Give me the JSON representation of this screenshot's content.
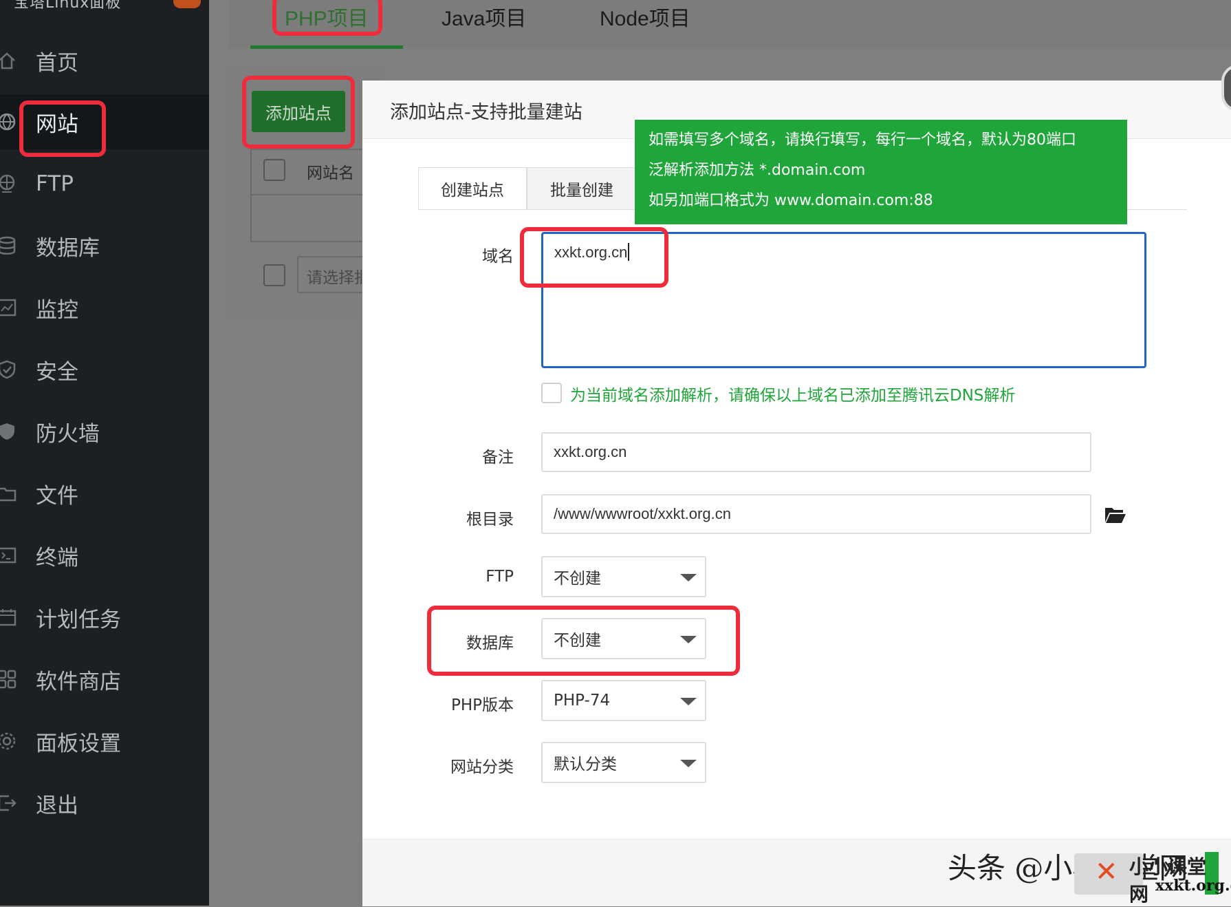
{
  "sidebar": {
    "brand": "宝塔Linux面板",
    "items": [
      {
        "label": "首页",
        "icon": "home-icon"
      },
      {
        "label": "网站",
        "icon": "globe-icon"
      },
      {
        "label": "FTP",
        "icon": "ftp-icon"
      },
      {
        "label": "数据库",
        "icon": "database-icon"
      },
      {
        "label": "监控",
        "icon": "monitor-icon"
      },
      {
        "label": "安全",
        "icon": "shield-check-icon"
      },
      {
        "label": "防火墙",
        "icon": "firewall-icon"
      },
      {
        "label": "文件",
        "icon": "folder-icon"
      },
      {
        "label": "终端",
        "icon": "terminal-icon"
      },
      {
        "label": "计划任务",
        "icon": "calendar-icon"
      },
      {
        "label": "软件商店",
        "icon": "apps-icon"
      },
      {
        "label": "面板设置",
        "icon": "gear-icon"
      },
      {
        "label": "退出",
        "icon": "logout-icon"
      }
    ]
  },
  "top_tabs": [
    "PHP项目",
    "Java项目",
    "Node项目"
  ],
  "background": {
    "add_site_button": "添加站点",
    "column_site_name": "网站名",
    "batch_select_placeholder": "请选择批"
  },
  "modal": {
    "title": "添加站点-支持批量建站",
    "tabs": [
      "创建站点",
      "批量创建"
    ],
    "tooltip": [
      "如需填写多个域名，请换行填写，每行一个域名，默认为80端口",
      "泛解析添加方法 *.domain.com",
      "如另加端口格式为 www.domain.com:88"
    ],
    "form": {
      "domain_label": "域名",
      "domain_value": "xxkt.org.cn",
      "dns_checkbox_label": "为当前域名添加解析，请确保以上域名已添加至腾讯云DNS解析",
      "remark_label": "备注",
      "remark_value": "xxkt.org.cn",
      "root_label": "根目录",
      "root_value": "/www/wwwroot/xxkt.org.cn",
      "ftp_label": "FTP",
      "ftp_value": "不创建",
      "db_label": "数据库",
      "db_value": "不创建",
      "php_label": "PHP版本",
      "php_value": "PHP-74",
      "category_label": "网站分类",
      "category_value": "默认分类"
    }
  },
  "watermark": {
    "text": "头条 @小小课堂网",
    "logo_text": "小小课堂网",
    "logo_url": "xxkt.org.cn"
  },
  "colors": {
    "accent_green": "#20a53a",
    "highlight_red": "#ee2d3c",
    "focus_blue": "#1f65c7"
  }
}
